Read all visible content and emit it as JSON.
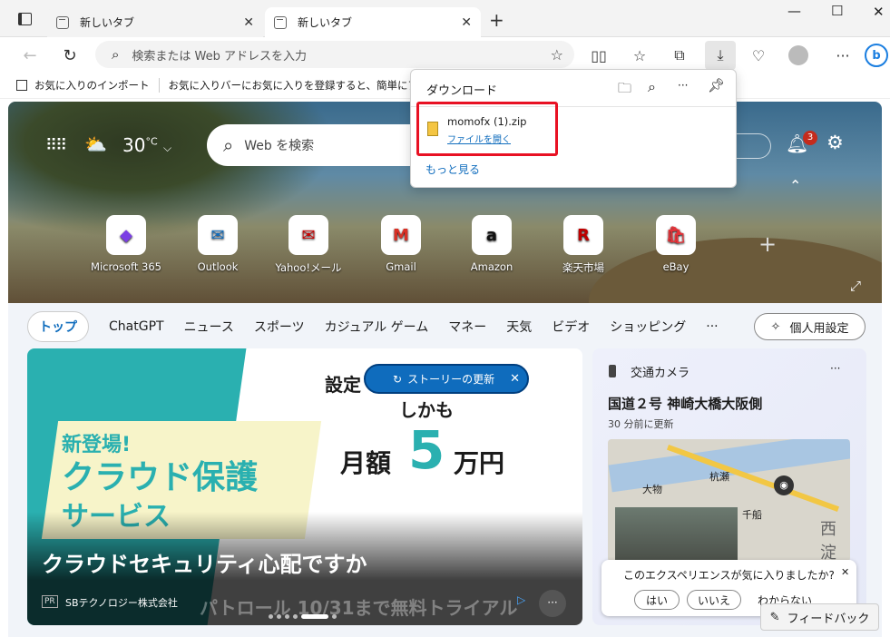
{
  "tabs": [
    {
      "label": "新しいタブ",
      "active": false
    },
    {
      "label": "新しいタブ",
      "active": true
    }
  ],
  "new_tab_symbol": "+",
  "window": {
    "minimize": "—",
    "maximize": "☐",
    "close": "✕"
  },
  "address": {
    "placeholder": "検索または Web アドレスを入力"
  },
  "favorites_bar": {
    "import": "お気に入りのインポート",
    "hint": "お気に入りバーにお気に入りを登録すると、簡単にアクセスで"
  },
  "weather": {
    "temp": "30",
    "unit": "°C"
  },
  "web_search": {
    "placeholder": "Web を検索"
  },
  "notification_count": "3",
  "quick_links": [
    {
      "label": "Microsoft 365",
      "glyph": "◆",
      "color": "#7b3fe4"
    },
    {
      "label": "Outlook",
      "glyph": "✉",
      "color": "#0f6cbd"
    },
    {
      "label": "Yahoo!メール",
      "glyph": "✉",
      "color": "#c00"
    },
    {
      "label": "Gmail",
      "glyph": "M",
      "color": "#d93025"
    },
    {
      "label": "Amazon",
      "glyph": "a",
      "color": "#111"
    },
    {
      "label": "楽天市場",
      "glyph": "R",
      "color": "#bf0000"
    },
    {
      "label": "eBay",
      "glyph": "🛍",
      "color": "#e53238"
    }
  ],
  "nav": {
    "items": [
      "トップ",
      "ChatGPT",
      "ニュース",
      "スポーツ",
      "カジュアル ゲーム",
      "マネー",
      "天気",
      "ビデオ",
      "ショッピング",
      "···"
    ],
    "personal": "個人用設定"
  },
  "ad": {
    "label_new": "新登場!",
    "label_main": "クラウド保護",
    "label_sub": "サービス",
    "line1": "設定",
    "line2": "しかも",
    "line3a": "月額",
    "line3b": "5",
    "line3c": "万円",
    "headline": "クラウドセキュリティ心配ですか",
    "ticker": "パトロール 10/31まで無料トライアル",
    "pr": "PR",
    "sponsor": "SBテクノロジー株式会社"
  },
  "story_update": "ストーリーの更新",
  "traffic": {
    "title": "交通カメラ",
    "place": "国道２号 神崎大橋大阪側",
    "updated": "30 分前に更新",
    "map_labels": [
      "杭瀬",
      "大物",
      "千船",
      "西淀"
    ]
  },
  "survey": {
    "question": "このエクスペリエンスが気に入りましたか?",
    "yes": "はい",
    "no": "いいえ",
    "unknown": "わからない"
  },
  "feedback": "フィードバック",
  "downloads": {
    "title": "ダウンロード",
    "file_name": "momofx (1).zip",
    "open_file": "ファイルを開く",
    "more": "もっと見る"
  },
  "colors": {
    "accent": "#0f6cbd",
    "highlight": "#e81123",
    "teal": "#2ab0b0"
  }
}
